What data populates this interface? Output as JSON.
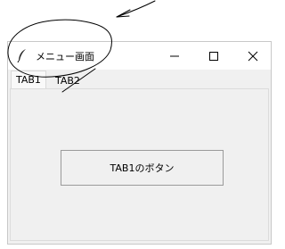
{
  "window": {
    "title": "メニュー画面",
    "app_icon": "feather-icon",
    "controls": {
      "minimize_icon": "minimize-icon",
      "maximize_icon": "maximize-icon",
      "close_icon": "close-icon"
    }
  },
  "tabs": [
    {
      "label": "TAB1",
      "selected": true
    },
    {
      "label": "TAB2",
      "selected": false
    }
  ],
  "panel": {
    "button_label": "TAB1のボタン"
  },
  "colors": {
    "window_bg": "#f0f0f0",
    "titlebar_bg": "#ffffff",
    "annotation_ink": "#000000"
  }
}
